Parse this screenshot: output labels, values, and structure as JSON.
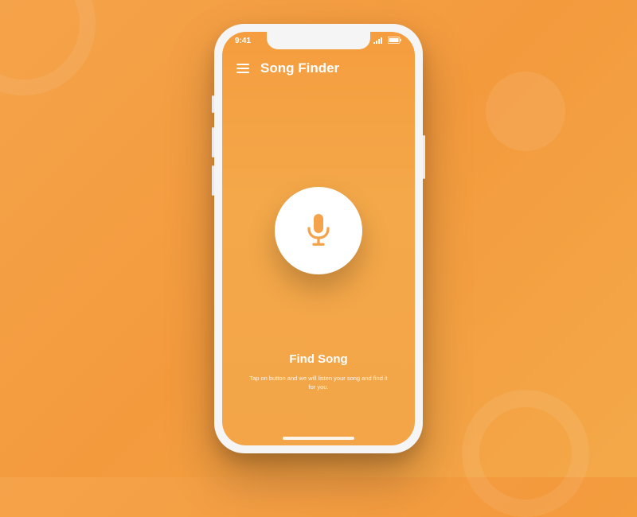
{
  "status": {
    "time": "9:41"
  },
  "header": {
    "title": "Song Finder"
  },
  "cta": {
    "title": "Find Song",
    "subtitle": "Tap on button and we will listen your song and find it for you."
  },
  "colors": {
    "accent": "#f5a34a",
    "mic": "#f5a34a"
  }
}
